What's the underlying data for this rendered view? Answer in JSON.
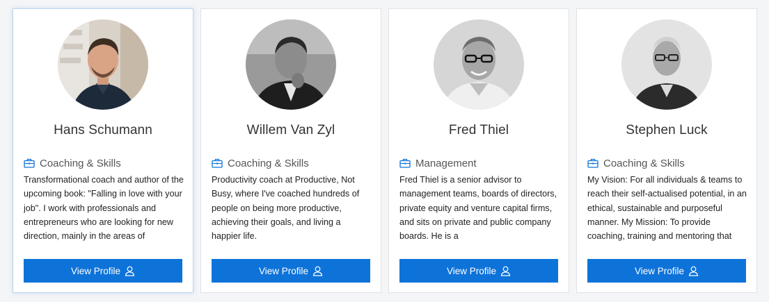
{
  "accent_color": "#0e73d9",
  "coaches": [
    {
      "name": "Hans Schumann",
      "category": "Coaching & Skills",
      "category_icon": "briefcase-icon",
      "description": "Transformational coach and author of the upcoming book: \"Falling in love with your job\". I work with professionals and entrepreneurs who are looking for new direction, mainly in the areas of",
      "button_label": "View Profile",
      "button_icon": "user-icon"
    },
    {
      "name": "Willem Van Zyl",
      "category": "Coaching & Skills",
      "category_icon": "briefcase-icon",
      "description": "Productivity coach at Productive, Not Busy, where I've coached hundreds of people on being more productive, achieving their goals, and living a happier life.",
      "button_label": "View Profile",
      "button_icon": "user-icon"
    },
    {
      "name": "Fred Thiel",
      "category": "Management",
      "category_icon": "briefcase-icon",
      "description": "Fred Thiel is a senior advisor to management teams, boards of directors, private equity and venture capital firms, and sits on private and public company boards. He is a",
      "button_label": "View Profile",
      "button_icon": "user-icon"
    },
    {
      "name": "Stephen Luck",
      "category": "Coaching & Skills",
      "category_icon": "briefcase-icon",
      "description": "My Vision: For all individuals & teams to reach their self-actualised potential, in an ethical, sustainable and purposeful manner. My Mission: To provide coaching, training and mentoring that",
      "button_label": "View Profile",
      "button_icon": "user-icon"
    }
  ]
}
